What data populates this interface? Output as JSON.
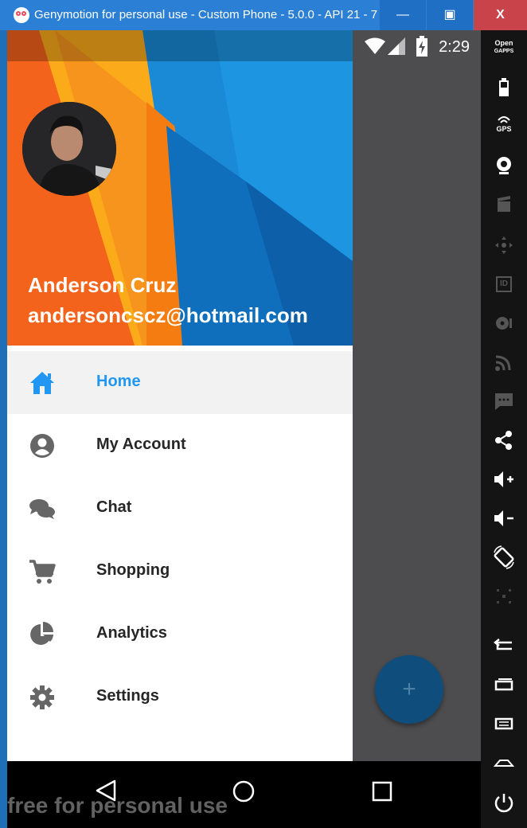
{
  "window": {
    "title": "Genymotion for personal use - Custom Phone - 5.0.0 - API 21 - 7...",
    "minimize_label": "—",
    "maximize_label": "▣",
    "close_label": "X"
  },
  "statusbar": {
    "time": "2:29"
  },
  "drawer": {
    "user_name": "Anderson Cruz",
    "user_email": "andersoncscz@hotmail.com",
    "items": [
      {
        "label": "Home",
        "icon": "home-icon",
        "active": true
      },
      {
        "label": "My Account",
        "icon": "account-circle-icon",
        "active": false
      },
      {
        "label": "Chat",
        "icon": "chat-bubbles-icon",
        "active": false
      },
      {
        "label": "Shopping",
        "icon": "shopping-cart-icon",
        "active": false
      },
      {
        "label": "Analytics",
        "icon": "pie-chart-icon",
        "active": false
      },
      {
        "label": "Settings",
        "icon": "gear-icon",
        "active": false
      }
    ]
  },
  "fab": {
    "label": "+"
  },
  "watermark": "free for personal use",
  "toolbar": {
    "open_gapps_line1": "Open",
    "open_gapps_line2": "GAPPS",
    "gps_label": "GPS",
    "id_label": "ID"
  },
  "colors": {
    "accent": "#2196f3",
    "title_bar": "#2b7fd4",
    "scrim": "#4d4d4f"
  }
}
